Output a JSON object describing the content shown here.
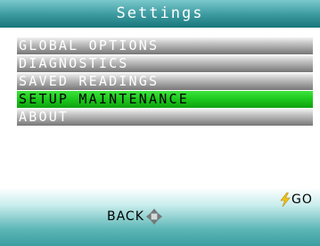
{
  "screen": {
    "title": "Settings"
  },
  "menu": {
    "items": [
      {
        "label": "GLOBAL OPTIONS",
        "selected": false
      },
      {
        "label": "DIAGNOSTICS",
        "selected": false
      },
      {
        "label": "SAVED READINGS",
        "selected": false
      },
      {
        "label": "SETUP MAINTENANCE",
        "selected": true
      },
      {
        "label": "ABOUT",
        "selected": false
      }
    ]
  },
  "softkeys": {
    "go": {
      "label": "GO",
      "icon": "lightning-icon"
    },
    "back": {
      "label": "BACK",
      "icon": "dpad-arrows-icon"
    }
  },
  "colors": {
    "title_bar": "#3f9da2",
    "selected_item": "#1ecb1e",
    "menu_item": "#9a9a9a",
    "bottom_bar": "#5bb5b5",
    "go_icon": "#f2c21b"
  }
}
